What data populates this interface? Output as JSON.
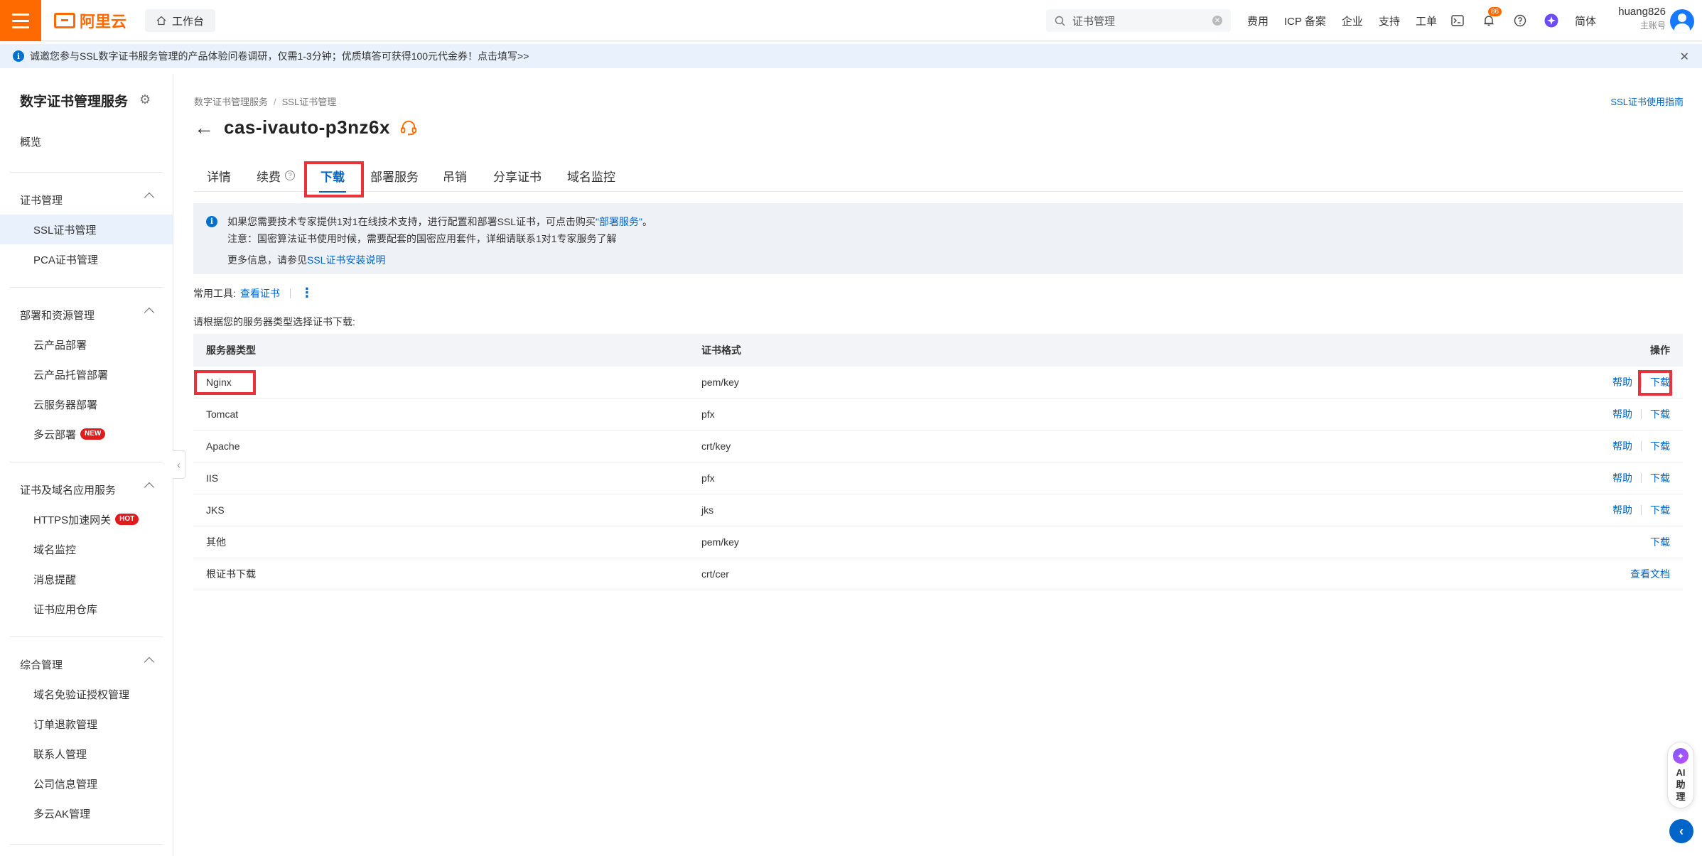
{
  "topbar": {
    "brand": "阿里云",
    "workbench": "工作台",
    "search_value": "证书管理",
    "nav": [
      "费用",
      "ICP 备案",
      "企业",
      "支持",
      "工单"
    ],
    "notification_count": "86",
    "lang": "简体",
    "user_name": "huang826",
    "user_role": "主账号",
    "accent_color": "#ff6a00"
  },
  "banner": {
    "text": "诚邀您参与SSL数字证书服务管理的产品体验问卷调研，仅需1-3分钟；优质填答可获得100元代金券！点击填写>>"
  },
  "sidebar": {
    "title": "数字证书管理服务",
    "overview": "概览",
    "groups": [
      {
        "label": "证书管理",
        "items": [
          "SSL证书管理",
          "PCA证书管理"
        ]
      },
      {
        "label": "部署和资源管理",
        "items": [
          "云产品部署",
          "云产品托管部署",
          "云服务器部署",
          "多云部署"
        ]
      },
      {
        "label": "证书及域名应用服务",
        "items": [
          "HTTPS加速网关",
          "域名监控",
          "消息提醒",
          "证书应用仓库"
        ]
      },
      {
        "label": "综合管理",
        "items": [
          "域名免验证授权管理",
          "订单退款管理",
          "联系人管理",
          "公司信息管理",
          "多云AK管理"
        ]
      }
    ],
    "tag_new": "NEW",
    "tag_hot": "HOT",
    "active_item": "SSL证书管理"
  },
  "page": {
    "breadcrumb": [
      "数字证书管理服务",
      "SSL证书管理"
    ],
    "guide_link": "SSL证书使用指南",
    "title": "cas-ivauto-p3nz6x",
    "tabs": [
      "详情",
      "续费",
      "下载",
      "部署服务",
      "吊销",
      "分享证书",
      "域名监控"
    ],
    "active_tab": "下载",
    "notice": {
      "line1_prefix": "如果您需要技术专家提供1对1在线技术支持，进行配置和部署SSL证书，可点击购买",
      "line1_link": "\"部署服务\"",
      "line1_suffix": "。",
      "line2": "注意：国密算法证书使用时候，需要配套的国密应用套件，详细请联系1对1专家服务了解",
      "line3_prefix": "更多信息，请参见",
      "line3_link": "SSL证书安装说明"
    },
    "tools_label": "常用工具:",
    "tools_link": "查看证书",
    "hint": "请根据您的服务器类型选择证书下载:",
    "table": {
      "headers": [
        "服务器类型",
        "证书格式",
        "操作"
      ],
      "rows": [
        {
          "server": "Nginx",
          "format": "pem/key",
          "help": "帮助",
          "action": "下载"
        },
        {
          "server": "Tomcat",
          "format": "pfx",
          "help": "帮助",
          "action": "下载"
        },
        {
          "server": "Apache",
          "format": "crt/key",
          "help": "帮助",
          "action": "下载"
        },
        {
          "server": "IIS",
          "format": "pfx",
          "help": "帮助",
          "action": "下载"
        },
        {
          "server": "JKS",
          "format": "jks",
          "help": "帮助",
          "action": "下载"
        },
        {
          "server": "其他",
          "format": "pem/key",
          "help": "",
          "action": "下载"
        },
        {
          "server": "根证书下载",
          "format": "crt/cer",
          "help": "",
          "action": "查看文档"
        }
      ]
    }
  },
  "float": {
    "ai_label": [
      "AI",
      "助",
      "理"
    ]
  },
  "highlight_color": "#e8323c",
  "link_color": "#0064c8"
}
